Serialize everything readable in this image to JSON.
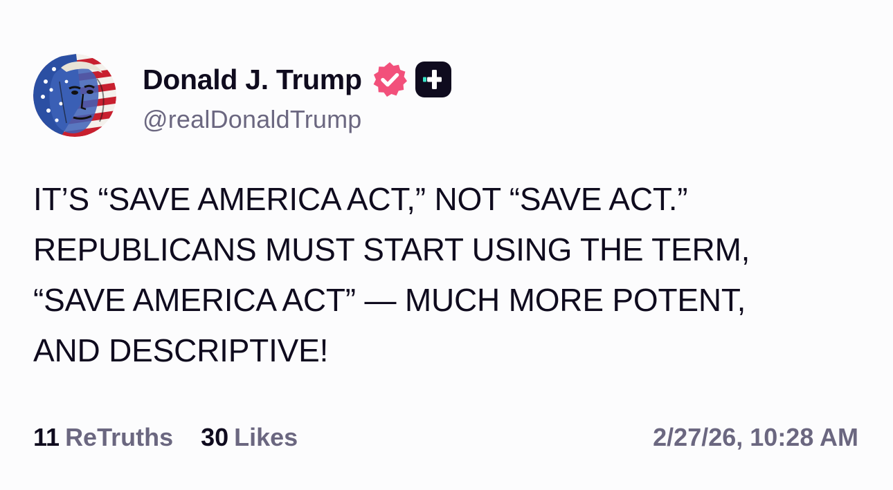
{
  "author": {
    "display_name": "Donald J. Trump",
    "handle": "@realDonaldTrump",
    "avatar_icon": "flag-portrait-avatar",
    "verified_icon": "verified-badge-icon",
    "plus_icon": "truth-plus-badge-icon"
  },
  "post": {
    "lines": [
      "IT’S “SAVE AMERICA ACT,” NOT “SAVE ACT.”",
      "REPUBLICANS MUST START USING THE TERM,",
      "“SAVE AMERICA ACT” — MUCH MORE POTENT,",
      "AND DESCRIPTIVE!"
    ]
  },
  "stats": {
    "retruths_count": "11",
    "retruths_label": "ReTruths",
    "likes_count": "30",
    "likes_label": "Likes",
    "timestamp": "2/27/26, 10:28 AM"
  },
  "colors": {
    "text": "#0f0b1e",
    "muted": "#6b6780",
    "verified": "#f2507b",
    "plus_badge_bg": "#0f0b1e",
    "plus_badge_accent": "#39e3c7",
    "background": "#fcfcfd"
  }
}
